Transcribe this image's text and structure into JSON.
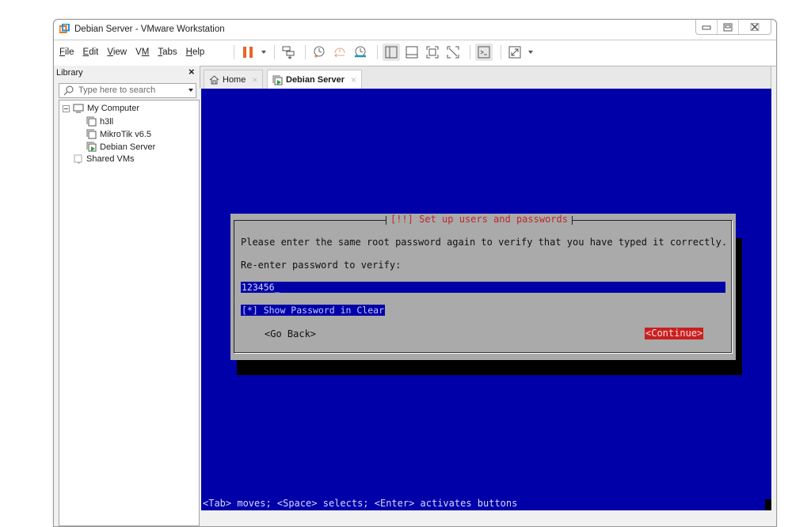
{
  "window": {
    "title": "Debian Server - VMware Workstation",
    "controls": {
      "minimize": "minimize",
      "maximize": "maximize",
      "close": "close"
    }
  },
  "menubar": {
    "items": [
      {
        "label": "File",
        "accel": "F"
      },
      {
        "label": "Edit",
        "accel": "E"
      },
      {
        "label": "View",
        "accel": "V"
      },
      {
        "label": "VM",
        "accel": "M"
      },
      {
        "label": "Tabs",
        "accel": "T"
      },
      {
        "label": "Help",
        "accel": "H"
      }
    ]
  },
  "toolbar": {
    "icons": [
      "pause-icon",
      "dropdown-icon",
      "send-ctrl-alt-del-icon",
      "snapshot-icon",
      "revert-snapshot-icon",
      "snapshot-manager-icon",
      "show-library-icon",
      "thumbnail-bar-icon",
      "full-screen-icon",
      "unity-icon",
      "console-view-icon",
      "stretch-guest-icon",
      "dropdown-icon"
    ]
  },
  "library": {
    "title": "Library",
    "close": "×",
    "search_placeholder": "Type here to search",
    "tree": [
      {
        "label": "My Computer",
        "level": 0,
        "icon": "computer-icon",
        "expanded": true
      },
      {
        "label": "h3ll",
        "level": 1,
        "icon": "vm-icon"
      },
      {
        "label": "MikroTik v6.5",
        "level": 1,
        "icon": "vm-icon"
      },
      {
        "label": "Debian Server",
        "level": 1,
        "icon": "vm-running-icon"
      },
      {
        "label": "Shared VMs",
        "level": 0,
        "icon": "shared-vms-icon"
      }
    ]
  },
  "tabs": [
    {
      "label": "Home",
      "active": false
    },
    {
      "label": "Debian Server",
      "active": true
    }
  ],
  "installer": {
    "dialog_title": "[!!] Set up users and passwords",
    "prompt": "Please enter the same root password again to verify that you have typed it correctly.",
    "field_label": "Re-enter password to verify:",
    "password_value": "123456",
    "show_password_checkbox": "[*] Show Password in Clear",
    "show_password_checked": true,
    "go_back": "<Go Back>",
    "continue": "<Continue>",
    "hint": "<Tab> moves; <Space> selects; <Enter> activates buttons"
  },
  "colors": {
    "console_bg": "#0000a8",
    "dialog_bg": "#aaaaaa",
    "title_red": "#c0262a",
    "button_selected": "#c82020",
    "pause_orange": "#e8642a"
  }
}
